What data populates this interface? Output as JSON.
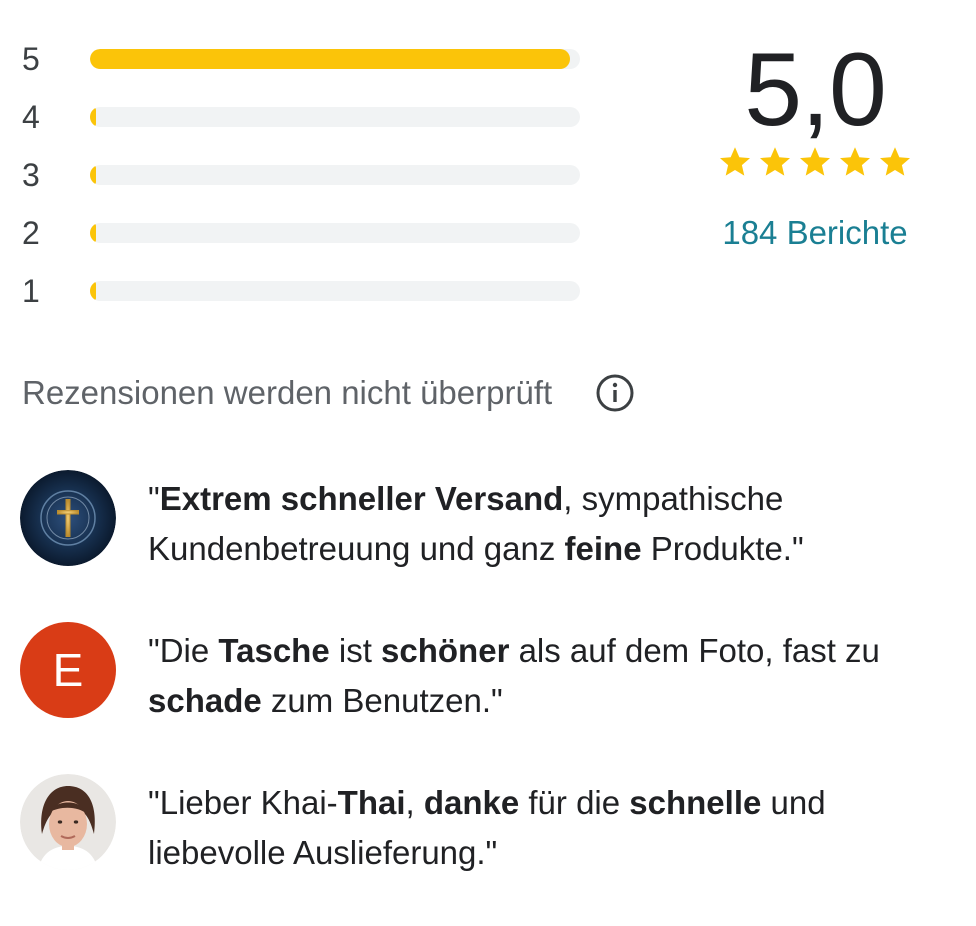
{
  "histogram": {
    "bar_color": "#fbc409",
    "track_color": "#f1f3f4",
    "rows": [
      {
        "label": "5",
        "fraction": 0.98
      },
      {
        "label": "4",
        "fraction": 0.01
      },
      {
        "label": "3",
        "fraction": 0.005
      },
      {
        "label": "2",
        "fraction": 0.005
      },
      {
        "label": "1",
        "fraction": 0.005
      }
    ]
  },
  "summary": {
    "score": "5,0",
    "stars_filled": 5,
    "star_color": "#fbc409",
    "reports_link": "184 Berichte",
    "link_color": "#1a7f93"
  },
  "disclaimer": {
    "text": "Rezensionen werden nicht überprüft",
    "icon": "info-icon"
  },
  "reviews": [
    {
      "avatar": {
        "type": "image",
        "description_icon": "cross-globe-avatar"
      },
      "segments": [
        {
          "t": "\"",
          "b": false
        },
        {
          "t": "Extrem schneller Versand",
          "b": true
        },
        {
          "t": ", sympathische Kundenbetreuung und ganz ",
          "b": false
        },
        {
          "t": "feine",
          "b": true
        },
        {
          "t": " Produkte.\"",
          "b": false
        }
      ]
    },
    {
      "avatar": {
        "type": "letter",
        "letter": "E",
        "color": "#d93c16"
      },
      "segments": [
        {
          "t": "\"Die ",
          "b": false
        },
        {
          "t": "Tasche",
          "b": true
        },
        {
          "t": " ist ",
          "b": false
        },
        {
          "t": "schöner",
          "b": true
        },
        {
          "t": " als auf dem Foto, fast zu ",
          "b": false
        },
        {
          "t": "schade",
          "b": true
        },
        {
          "t": " zum Benutzen.\"",
          "b": false
        }
      ]
    },
    {
      "avatar": {
        "type": "photo",
        "description_icon": "person-photo-avatar"
      },
      "segments": [
        {
          "t": "\"Lieber Khai-",
          "b": false
        },
        {
          "t": "Thai",
          "b": true
        },
        {
          "t": ", ",
          "b": false
        },
        {
          "t": "danke",
          "b": true
        },
        {
          "t": " für die ",
          "b": false
        },
        {
          "t": "schnelle",
          "b": true
        },
        {
          "t": " und liebevolle Auslieferung.\"",
          "b": false
        }
      ]
    }
  ]
}
